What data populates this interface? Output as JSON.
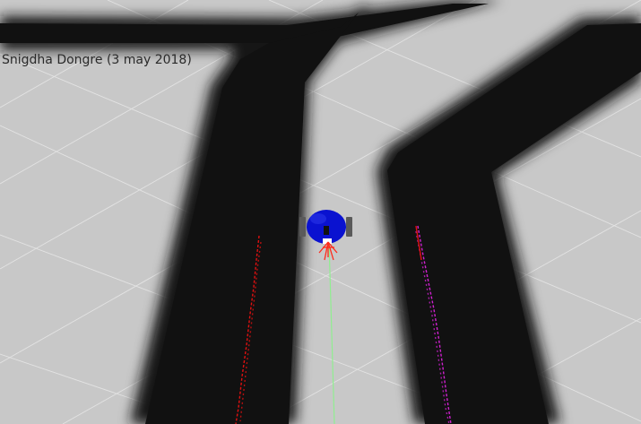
{
  "viewer": {
    "caption": "Snigdha Dongre (3 may 2018)"
  },
  "colors": {
    "ground": "#c8c8c8",
    "grid": "#e6e6e6",
    "track": "#131313",
    "robot_body": "#0a12d0",
    "robot_wheel": "#5a5a5a",
    "left_lane_points": "#e01010",
    "right_lane_points": "#d020d0",
    "heading_line": "#90ee90",
    "robot_marker": "#ff2a1a"
  }
}
